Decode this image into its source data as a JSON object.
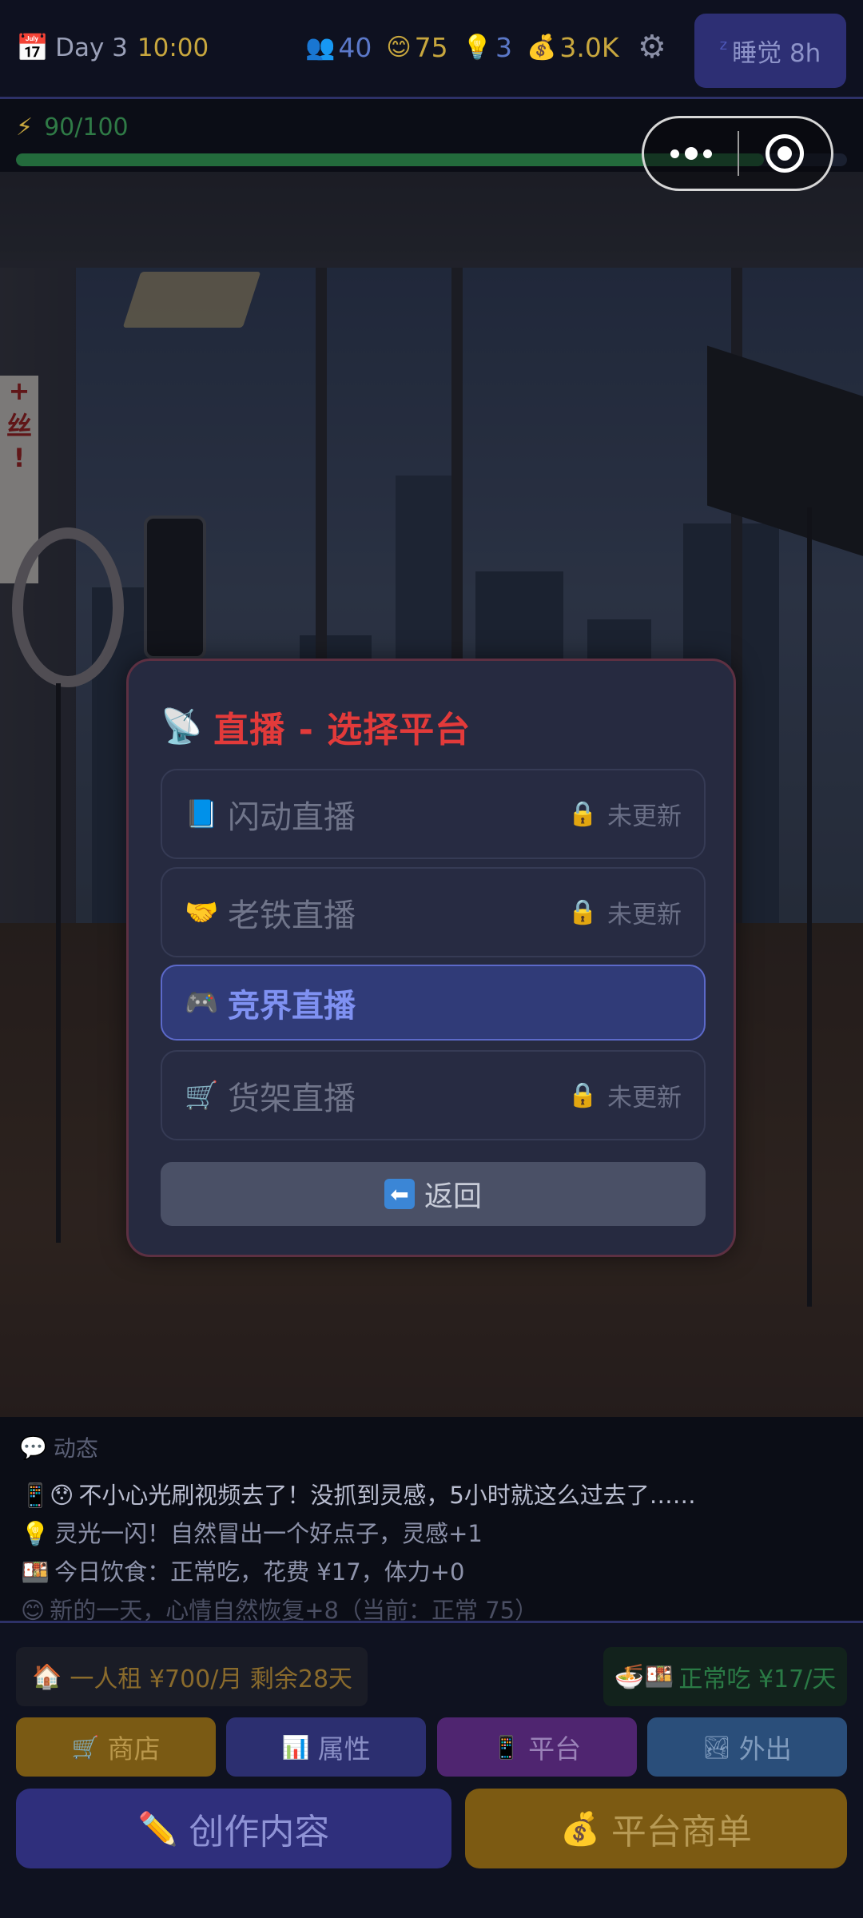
{
  "status": {
    "day": "Day 3",
    "time": "10:00",
    "fans": "40",
    "mood": "75",
    "inspiration": "3",
    "money": "3.0K",
    "sleep_label": "睡觉 8h"
  },
  "energy": {
    "label": "90/100",
    "fraction": 0.9
  },
  "scene_poster": [
    "+",
    "丝",
    "!"
  ],
  "modal": {
    "title": "直播 - 选择平台",
    "options": [
      {
        "icon": "📘",
        "name": "闪动直播",
        "status": "未更新",
        "locked": true
      },
      {
        "icon": "🤝",
        "name": "老铁直播",
        "status": "未更新",
        "locked": true
      },
      {
        "icon": "🎮",
        "name": "竞界直播",
        "status": "",
        "locked": false,
        "selected": true
      },
      {
        "icon": "🛒",
        "name": "货架直播",
        "status": "未更新",
        "locked": true
      }
    ],
    "back_label": "返回"
  },
  "feed": {
    "title": "动态",
    "lines": [
      "不小心光刷视频去了！没抓到灵感，5小时就这么过去了……",
      "灵光一闪！自然冒出一个好点子，灵感+1",
      "今日饮食：正常吃，花费 ¥17，体力+0",
      "新的一天，心情自然恢复+8（当前：正常 75）"
    ]
  },
  "bottom": {
    "rent": "一人租 ¥700/月 剩余28天",
    "meal": "正常吃 ¥17/天",
    "nav": {
      "shop": "商店",
      "attributes": "属性",
      "platform": "平台",
      "outing": "外出"
    },
    "create": "创作内容",
    "orders": "平台商单"
  },
  "colors": {
    "modal_title": "#e23a3a",
    "selected_option": "#7f91f2",
    "energy_fill": "#236b3c"
  }
}
